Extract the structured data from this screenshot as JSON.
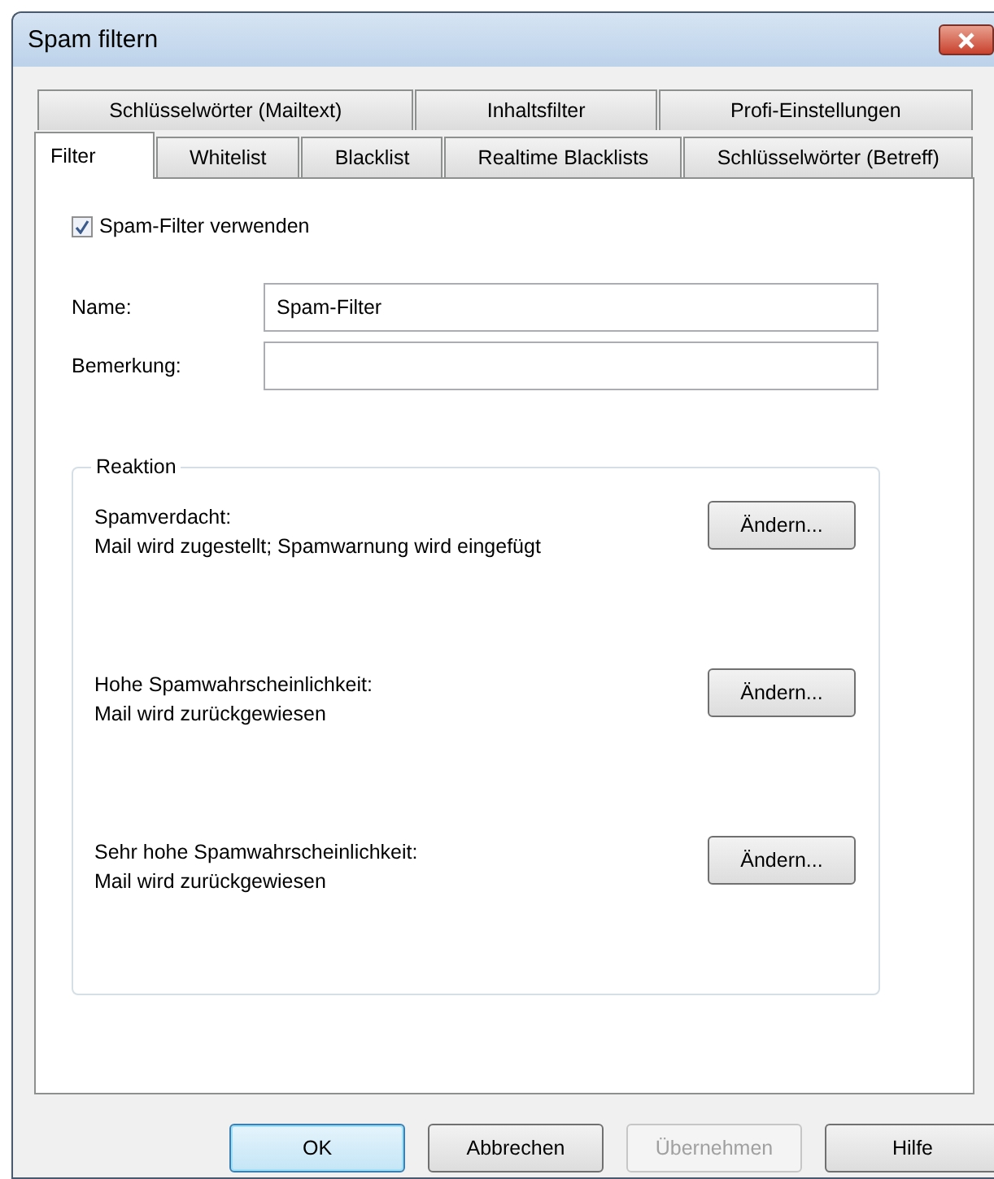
{
  "window": {
    "title": "Spam filtern"
  },
  "tab_rows": [
    [
      {
        "label": "Schlüsselwörter (Mailtext)",
        "selected": false
      },
      {
        "label": "Inhaltsfilter",
        "selected": false
      },
      {
        "label": "Profi-Einstellungen",
        "selected": false
      }
    ],
    [
      {
        "label": "Filter",
        "selected": true
      },
      {
        "label": "Whitelist",
        "selected": false
      },
      {
        "label": "Blacklist",
        "selected": false
      },
      {
        "label": "Realtime Blacklists",
        "selected": false
      },
      {
        "label": "Schlüsselwörter (Betreff)",
        "selected": false
      }
    ]
  ],
  "enable_checkbox": {
    "label": "Spam-Filter verwenden",
    "checked": true
  },
  "fields": [
    {
      "label": "Name:",
      "value": "Spam-Filter"
    },
    {
      "label": "Bemerkung:"
    }
  ],
  "group": {
    "title": "Reaktion",
    "items": [
      {
        "title": "Spamverdacht:",
        "detail": "Mail wird zugestellt; Spamwarnung wird eingefügt",
        "button": "Ändern..."
      },
      {
        "title": "Hohe Spamwahrscheinlichkeit:",
        "detail": "Mail wird zurückgewiesen",
        "button": "Ändern..."
      },
      {
        "title": "Sehr hohe Spamwahrscheinlichkeit:",
        "detail": "Mail wird zurückgewiesen",
        "button": "Ändern..."
      }
    ]
  },
  "buttons": [
    {
      "label": "OK",
      "default": true,
      "disabled": false
    },
    {
      "label": "Abbrechen",
      "default": false,
      "disabled": false
    },
    {
      "label": "Übernehmen",
      "default": false,
      "disabled": true
    },
    {
      "label": "Hilfe",
      "default": false,
      "disabled": false
    }
  ]
}
